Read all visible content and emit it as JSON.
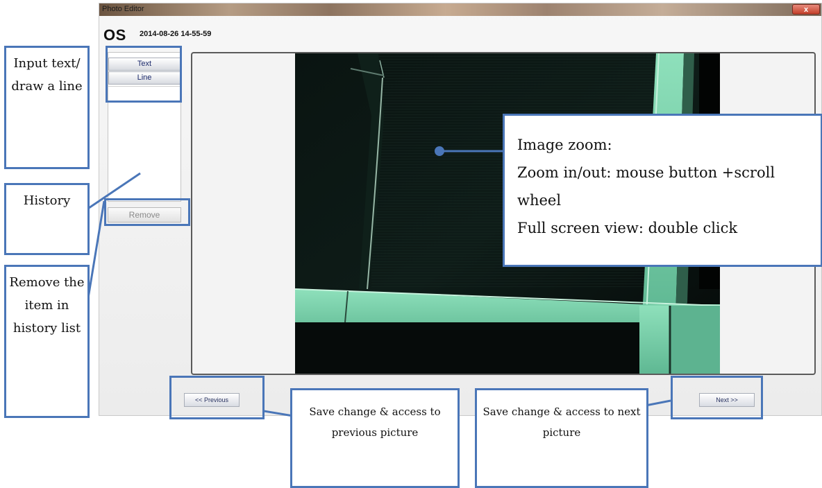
{
  "window": {
    "title": "Photo Editor",
    "close_label": "x",
    "eye_label": "OS",
    "timestamp": "2014-08-26 14-55-59"
  },
  "tools": {
    "text_label": "Text",
    "line_label": "Line",
    "remove_label": "Remove"
  },
  "navigation": {
    "previous_label": "<< Previous",
    "next_label": "Next >>"
  },
  "annotations": {
    "input": "Input text/ draw a line",
    "history": "History",
    "remove": "Remove the item in history list",
    "zoom_title": "Image zoom:",
    "zoom_in_out": "Zoom in/out: mouse button +scroll wheel",
    "zoom_fullscreen": "Full screen view: double click",
    "previous": "Save change & access to previous picture",
    "next": "Save change & access to next picture"
  },
  "colors": {
    "accent": "#4a76b8",
    "frame_highlight": "#7fd0ad"
  }
}
